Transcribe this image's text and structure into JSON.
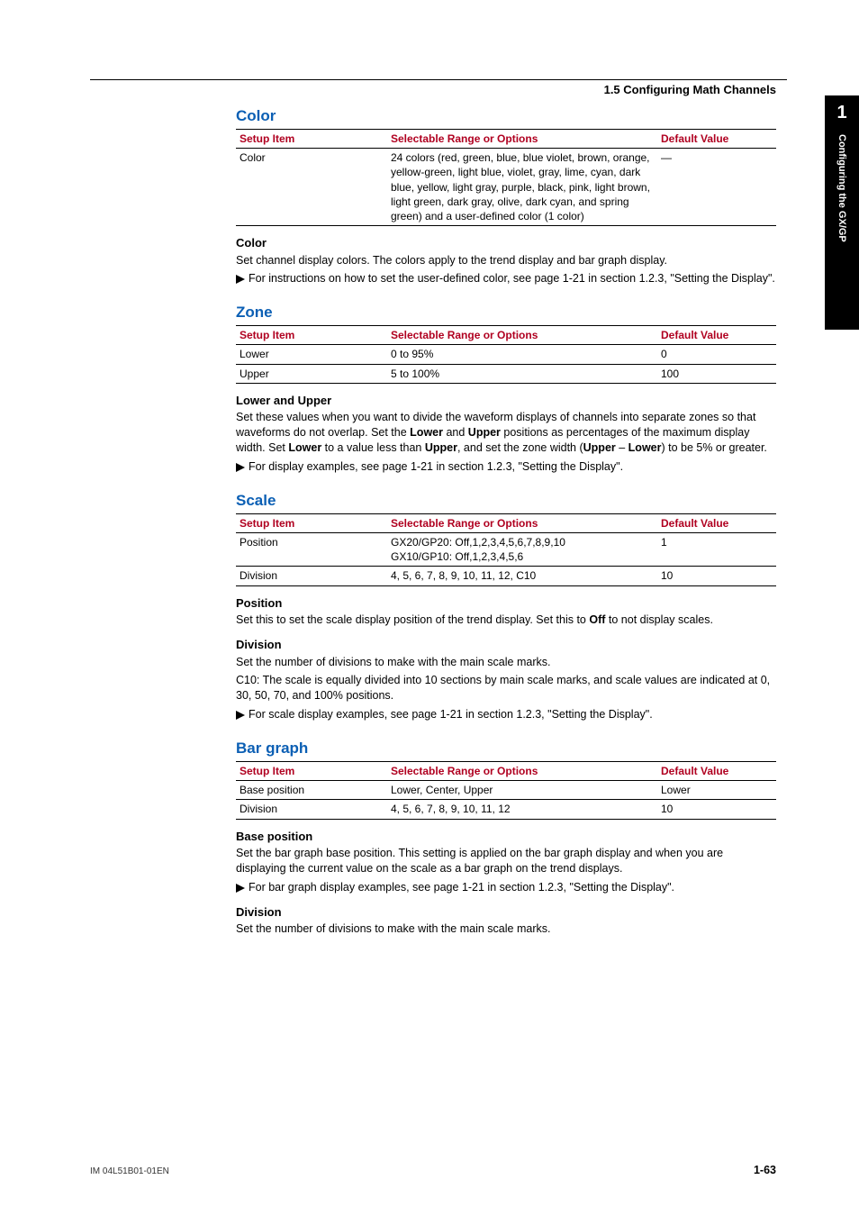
{
  "header": {
    "breadcrumb": "1.5  Configuring Math Channels"
  },
  "sideTab": {
    "chapter": "1",
    "label": "Configuring the GX/GP"
  },
  "tableHeaders": {
    "c1": "Setup Item",
    "c2": "Selectable Range or Options",
    "c3": "Default Value"
  },
  "color": {
    "title": "Color",
    "rows": [
      {
        "item": "Color",
        "opts": "24 colors (red, green, blue, blue violet, brown, orange, yellow-green, light blue, violet, gray, lime, cyan, dark blue, yellow, light gray, purple, black, pink, light brown, light green, dark gray, olive, dark cyan, and spring green) and a user-defined color (1 color)",
        "def": "—"
      }
    ],
    "sub": "Color",
    "p1": "Set channel display colors. The colors apply to the trend display and bar graph display.",
    "xref": "For instructions on how to set the user-defined color, see page 1-21 in section 1.2.3, \"Setting the Display\"."
  },
  "zone": {
    "title": "Zone",
    "rows": [
      {
        "item": "Lower",
        "opts": "0 to 95%",
        "def": "0"
      },
      {
        "item": "Upper",
        "opts": "5 to 100%",
        "def": "100"
      }
    ],
    "sub": "Lower and Upper",
    "p1a": "Set these values when you want to divide the waveform displays of channels into separate zones so that waveforms do not overlap. Set the ",
    "p1b": "Lower",
    "p1c": " and ",
    "p1d": "Upper",
    "p1e": " positions as percentages of the maximum display width. Set ",
    "p1f": "Lower",
    "p1g": " to a value less than ",
    "p1h": "Upper",
    "p1i": ", and set the zone width (",
    "p1j": "Upper",
    "p1k": " – ",
    "p1l": "Lower",
    "p1m": ") to be 5% or greater.",
    "xref": "For display examples, see page 1-21 in section 1.2.3, \"Setting the Display\"."
  },
  "scale": {
    "title": "Scale",
    "rows": [
      {
        "item": "Position",
        "opts": "GX20/GP20: Off,1,2,3,4,5,6,7,8,9,10\nGX10/GP10: Off,1,2,3,4,5,6",
        "def": "1"
      },
      {
        "item": "Division",
        "opts": "4, 5, 6, 7, 8, 9, 10, 11, 12, C10",
        "def": "10"
      }
    ],
    "sub1": "Position",
    "p1a": "Set this to set the scale display position of the trend display. Set this to ",
    "p1b": "Off",
    "p1c": " to not display scales.",
    "sub2": "Division",
    "p2": "Set the number of divisions to make with the main scale marks.",
    "p3": "C10: The scale is equally divided into 10 sections by main scale marks, and scale values are indicated at 0, 30, 50, 70, and 100% positions.",
    "xref": " For scale display examples, see page 1-21 in section 1.2.3, \"Setting the Display\"."
  },
  "bargraph": {
    "title": "Bar graph",
    "rows": [
      {
        "item": "Base position",
        "opts": "Lower, Center, Upper",
        "def": "Lower"
      },
      {
        "item": "Division",
        "opts": "4, 5, 6, 7, 8, 9, 10, 11, 12",
        "def": "10"
      }
    ],
    "sub1": "Base position",
    "p1": "Set the bar graph base position. This setting is applied on the bar graph display and when you are displaying the current value on the scale as a bar graph on the trend displays.",
    "xref": " For bar graph display examples, see page 1-21 in section 1.2.3, \"Setting the Display\".",
    "sub2": "Division",
    "p2": "Set the number of divisions to make with the main scale marks."
  },
  "footer": {
    "left": "IM 04L51B01-01EN",
    "right": "1-63"
  }
}
